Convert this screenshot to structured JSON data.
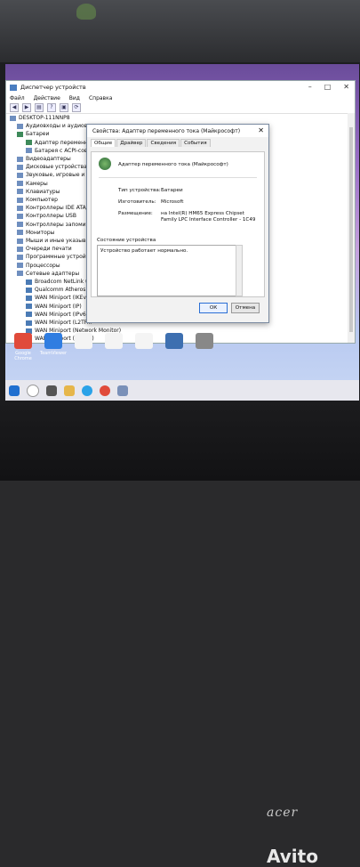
{
  "device_manager": {
    "title": "Диспетчер устройств",
    "menu": [
      "Файл",
      "Действие",
      "Вид",
      "Справка"
    ],
    "toolbar_icons": [
      "back-icon",
      "forward-icon",
      "properties-icon",
      "help-icon",
      "display-icon",
      "update-icon"
    ],
    "tree": [
      {
        "label": "DESKTOP-111NNP8",
        "level": 0
      },
      {
        "label": "Аудиовходы и аудиовых...",
        "level": 1
      },
      {
        "label": "Батареи",
        "level": 1
      },
      {
        "label": "Адаптер переменного то...",
        "level": 2
      },
      {
        "label": "Батарея с ACPI-совмест...",
        "level": 2
      },
      {
        "label": "Видеоадаптеры",
        "level": 1
      },
      {
        "label": "Дисковые устройства",
        "level": 1
      },
      {
        "label": "Звуковые, игровые и в...",
        "level": 1
      },
      {
        "label": "Камеры",
        "level": 1
      },
      {
        "label": "Клавиатуры",
        "level": 1
      },
      {
        "label": "Компьютер",
        "level": 1
      },
      {
        "label": "Контроллеры IDE ATA/...",
        "level": 1
      },
      {
        "label": "Контроллеры USB",
        "level": 1
      },
      {
        "label": "Контроллеры запомин...",
        "level": 1
      },
      {
        "label": "Мониторы",
        "level": 1
      },
      {
        "label": "Мыши и иные указыв...",
        "level": 1
      },
      {
        "label": "Очереди печати",
        "level": 1
      },
      {
        "label": "Программные устройс...",
        "level": 1
      },
      {
        "label": "Процессоры",
        "level": 1
      },
      {
        "label": "Сетевые адаптеры",
        "level": 1
      },
      {
        "label": "Broadcom NetLink (...",
        "level": 2
      },
      {
        "label": "Qualcomm Atheros ...",
        "level": 2
      },
      {
        "label": "WAN Miniport (IKEv...",
        "level": 2
      },
      {
        "label": "WAN Miniport (IP)",
        "level": 2
      },
      {
        "label": "WAN Miniport (IPv6...",
        "level": 2
      },
      {
        "label": "WAN Miniport (L2TP...",
        "level": 2
      },
      {
        "label": "WAN Miniport (Network Monitor)",
        "level": 2
      },
      {
        "label": "WAN Miniport (PPPOE)",
        "level": 2
      }
    ]
  },
  "dialog": {
    "title": "Свойства: Адаптер переменного тока (Майкрософт)",
    "tabs": [
      "Общие",
      "Драйвер",
      "Сведения",
      "События"
    ],
    "device_name": "Адаптер переменного тока (Майкрософт)",
    "fields": [
      {
        "label": "Тип устройства:",
        "value": "Батареи"
      },
      {
        "label": "Изготовитель:",
        "value": "Microsoft"
      },
      {
        "label": "Размещение:",
        "value": "на Intel(R) HM65 Express Chipset Family LPC Interface Controller - 1C49"
      }
    ],
    "status_caption": "Состояние устройства",
    "status_text": "Устройство работает нормально.",
    "ok_label": "ОК",
    "cancel_label": "Отмена"
  },
  "desktop_icons": [
    {
      "label": "Google Chrome",
      "color": "#e04a3a"
    },
    {
      "label": "TeamViewer",
      "color": "#2f7de1"
    },
    {
      "label": "",
      "color": "#f4f4f4"
    },
    {
      "label": "",
      "color": "#f4f4f4"
    },
    {
      "label": "",
      "color": "#f4f4f4"
    },
    {
      "label": "",
      "color": "#3d6fb0"
    },
    {
      "label": "",
      "color": "#888888"
    }
  ],
  "taskbar_icons": [
    "start-icon",
    "search-icon",
    "task-view-icon",
    "explorer-icon",
    "skype-icon",
    "chrome-icon",
    "device-manager-icon"
  ],
  "brand": {
    "laptop": "acer",
    "watermark": "Avito"
  }
}
